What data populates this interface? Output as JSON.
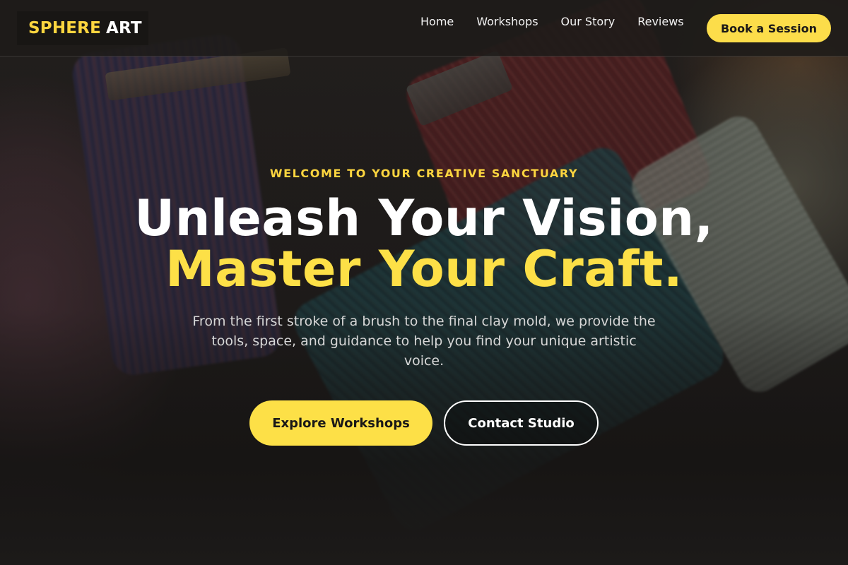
{
  "brand": {
    "name_part1": "SPHERE",
    "name_part2": "ART"
  },
  "nav": {
    "items": [
      {
        "label": "Home"
      },
      {
        "label": "Workshops"
      },
      {
        "label": "Our Story"
      },
      {
        "label": "Reviews"
      }
    ],
    "cta_label": "Book a Session"
  },
  "hero": {
    "eyebrow": "WELCOME TO YOUR CREATIVE SANCTUARY",
    "headline_line1": "Unleash Your Vision,",
    "headline_line2": "Master Your Craft.",
    "description": "From the first stroke of a brush to the final clay mold, we provide the tools, space, and guidance to help you find your unique artistic voice.",
    "primary_button": "Explore Workshops",
    "secondary_button": "Contact Studio"
  },
  "colors": {
    "accent": "#fde047",
    "header_bg": "#1e1b19",
    "text_primary": "#ffffff",
    "text_muted": "#d7d7d7"
  }
}
